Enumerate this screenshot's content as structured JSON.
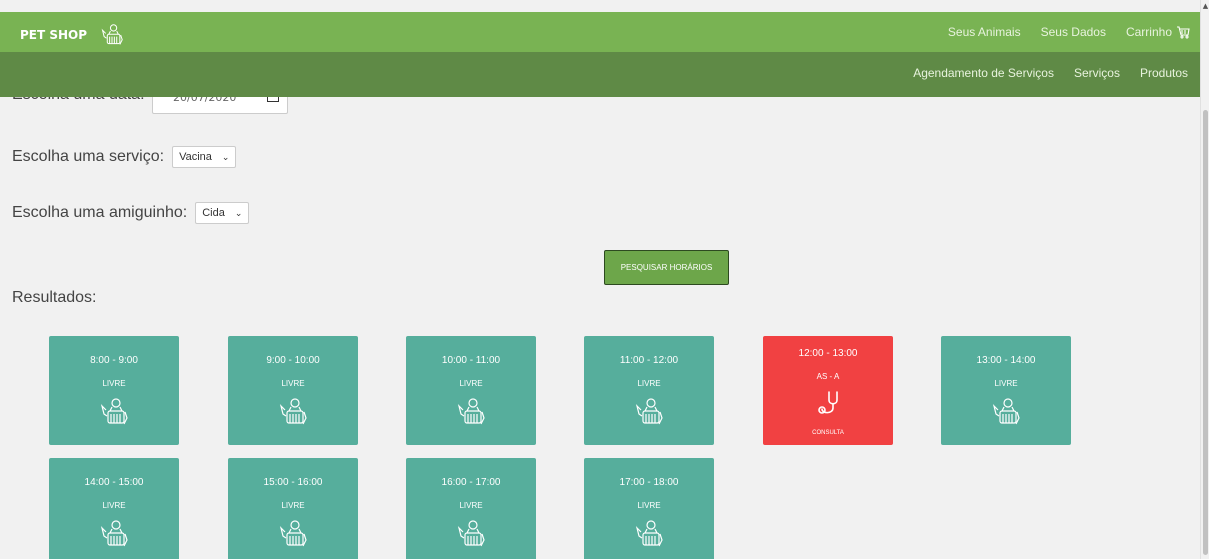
{
  "header": {
    "brand": "PET SHOP",
    "brand_icon": "pet-icon",
    "nav": [
      "Seus Animais",
      "Seus Dados"
    ],
    "cart_label": "Carrinho",
    "cart_icon": "cart-icon"
  },
  "subnav": [
    "Agendamento de Serviços",
    "Serviços",
    "Produtos"
  ],
  "form": {
    "date_label": "Escolha uma data:",
    "date_value": "20/07/2020",
    "service_label": "Escolha uma serviço:",
    "service_value": "Vacina",
    "pet_label": "Escolha uma amiguinho:",
    "pet_value": "Cida",
    "search_button": "PESQUISAR HORÁRIOS"
  },
  "results_title": "Resultados:",
  "slots": [
    {
      "time": "8:00 - 9:00",
      "status": "LIVRE",
      "icon": "pet-icon"
    },
    {
      "time": "9:00 - 10:00",
      "status": "LIVRE",
      "icon": "pet-icon"
    },
    {
      "time": "10:00 - 11:00",
      "status": "LIVRE",
      "icon": "pet-icon"
    },
    {
      "time": "11:00 - 12:00",
      "status": "LIVRE",
      "icon": "pet-icon"
    },
    {
      "time": "12:00 - 13:00",
      "status": "AS - A",
      "icon": "stethoscope-icon",
      "type": "CONSULTA"
    },
    {
      "time": "13:00 - 14:00",
      "status": "LIVRE",
      "icon": "pet-icon"
    },
    {
      "time": "14:00 - 15:00",
      "status": "LIVRE",
      "icon": "pet-icon"
    },
    {
      "time": "15:00 - 16:00",
      "status": "LIVRE",
      "icon": "pet-icon"
    },
    {
      "time": "16:00 - 17:00",
      "status": "LIVRE",
      "icon": "pet-icon"
    },
    {
      "time": "17:00 - 18:00",
      "status": "LIVRE",
      "icon": "pet-icon"
    }
  ],
  "colors": {
    "topbar": "#79b353",
    "subbar": "#5f8a46",
    "free_slot": "#56ae9c",
    "busy_slot": "#f14142",
    "button": "#6da64a"
  }
}
